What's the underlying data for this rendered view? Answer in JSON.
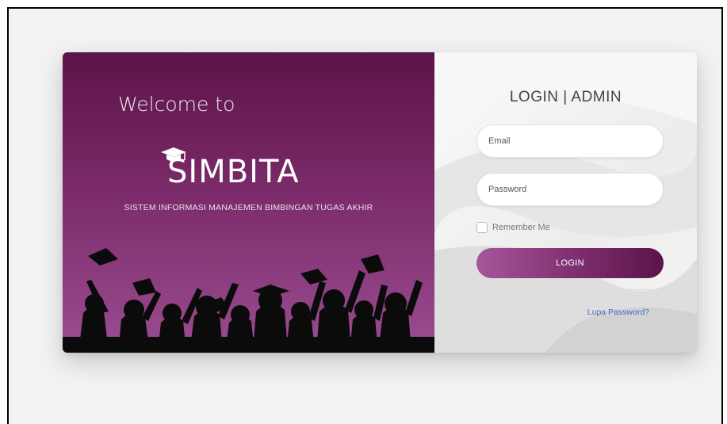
{
  "left_panel": {
    "welcome_text": "Welcome to",
    "logo_text": "SIMBITA",
    "tagline": "SISTEM INFORMASI MANAJEMEN BIMBINGAN TUGAS AKHIR"
  },
  "login_form": {
    "title": "LOGIN | ADMIN",
    "email_placeholder": "Email",
    "password_placeholder": "Password",
    "remember_label": "Remember Me",
    "login_button": "LOGIN",
    "forgot_link": "Lupa Password?"
  },
  "colors": {
    "primary": "#7c2d6d",
    "primary_dark": "#5b1448",
    "primary_light": "#a5579b",
    "link": "#4169c9"
  }
}
